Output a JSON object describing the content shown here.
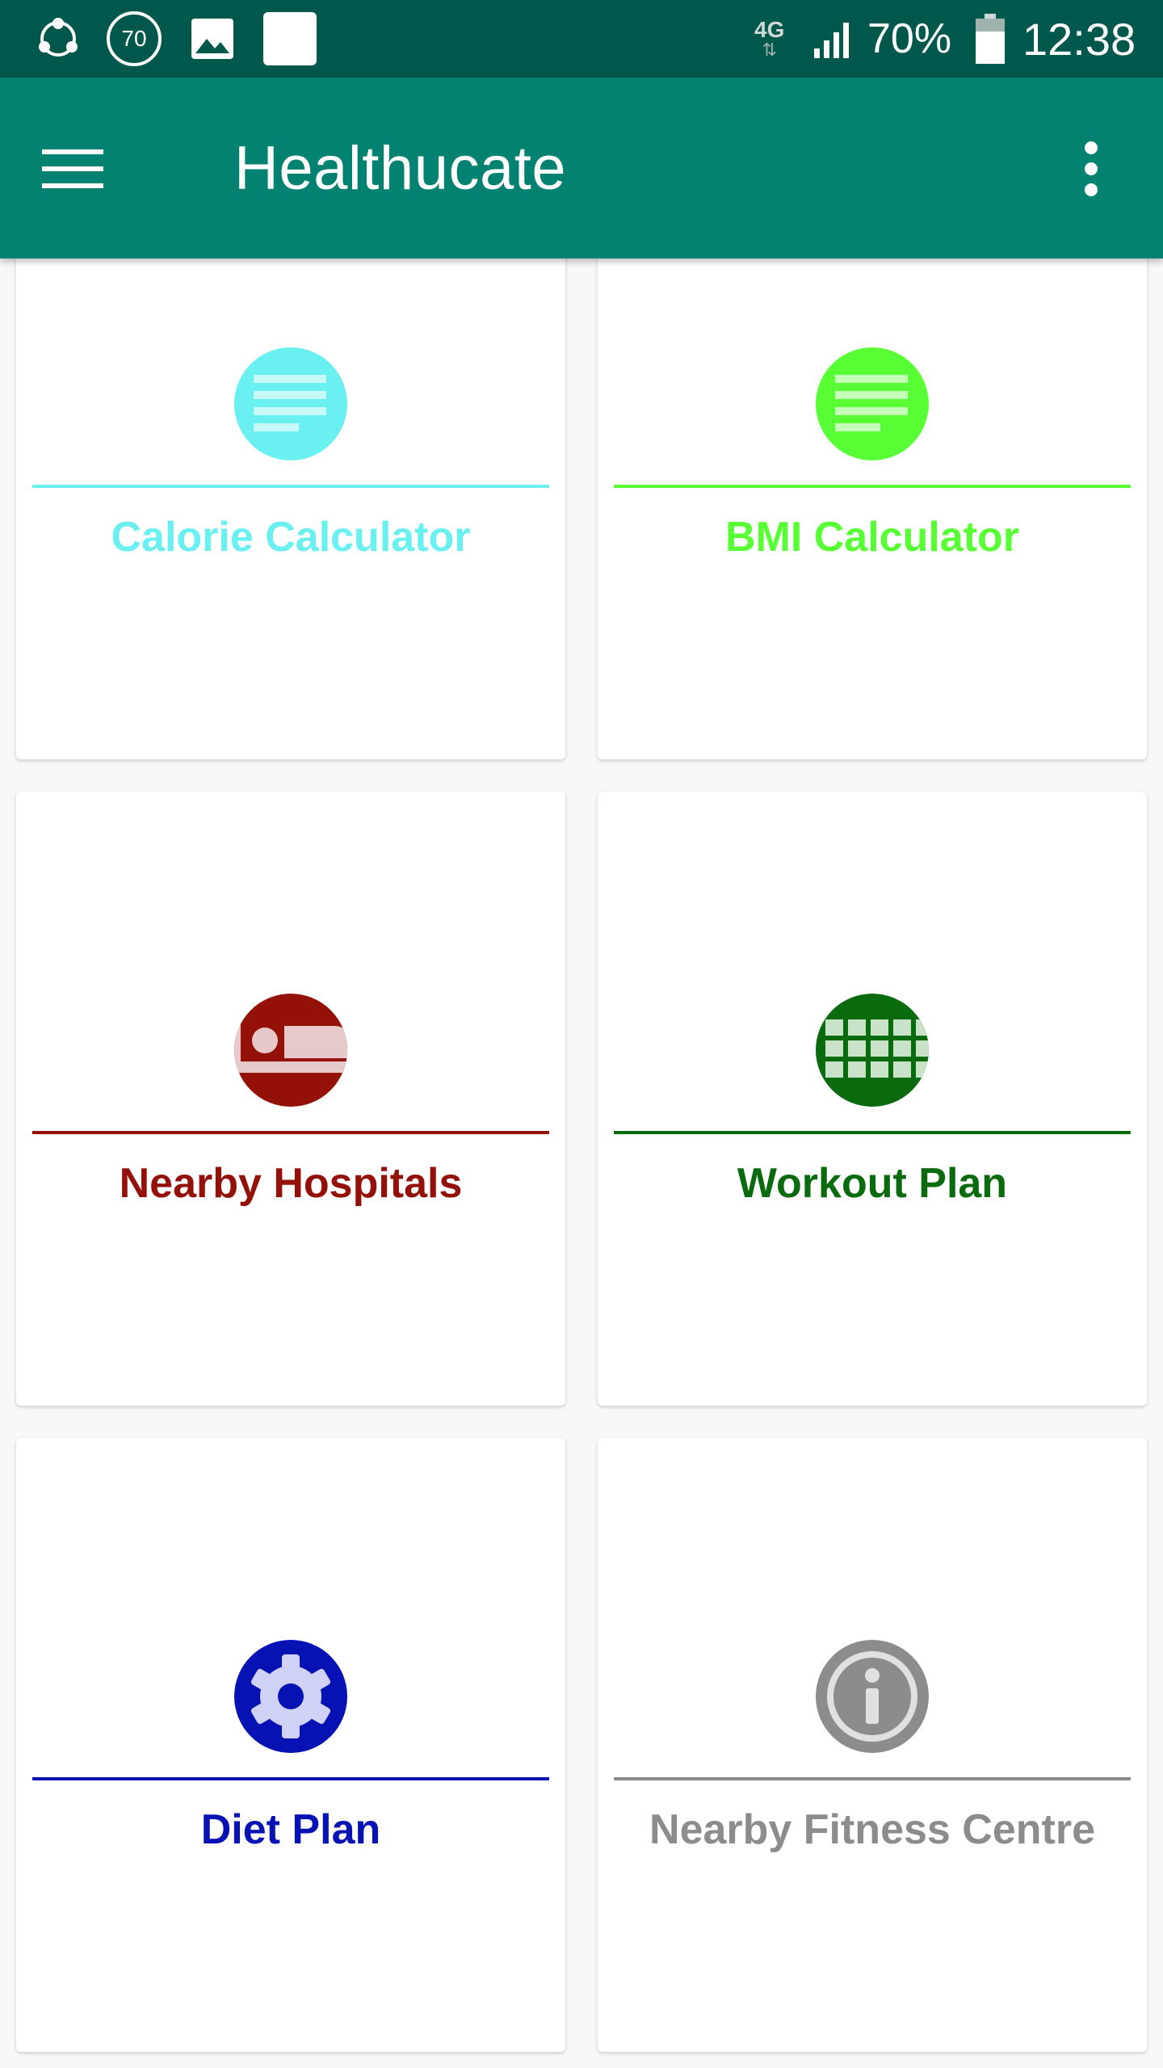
{
  "status_bar": {
    "badge_number": "70",
    "network": "4G",
    "battery_percent": "70%",
    "time": "12:38",
    "icons": [
      "share-it-icon",
      "badge-70-icon",
      "image-icon",
      "blank-square-icon",
      "4g-data-icon",
      "signal-icon",
      "battery-icon"
    ]
  },
  "app_bar": {
    "title": "Healthucate",
    "menu_icon": "hamburger-menu-icon",
    "overflow_icon": "more-vert-icon"
  },
  "tiles": [
    {
      "label": "Calorie Calculator",
      "icon": "notes-icon",
      "color": "#6af0f0"
    },
    {
      "label": "BMI Calculator",
      "icon": "notes-icon",
      "color": "#59ff35"
    },
    {
      "label": "Nearby Hospitals",
      "icon": "hospital-bed-icon",
      "color": "#931108"
    },
    {
      "label": "Workout Plan",
      "icon": "grid-calendar-icon",
      "color": "#0a6a0e"
    },
    {
      "label": "Diet Plan",
      "icon": "gear-icon",
      "color": "#0612b3"
    },
    {
      "label": "Nearby Fitness Centre",
      "icon": "info-icon",
      "color": "#8c8c8c"
    }
  ]
}
